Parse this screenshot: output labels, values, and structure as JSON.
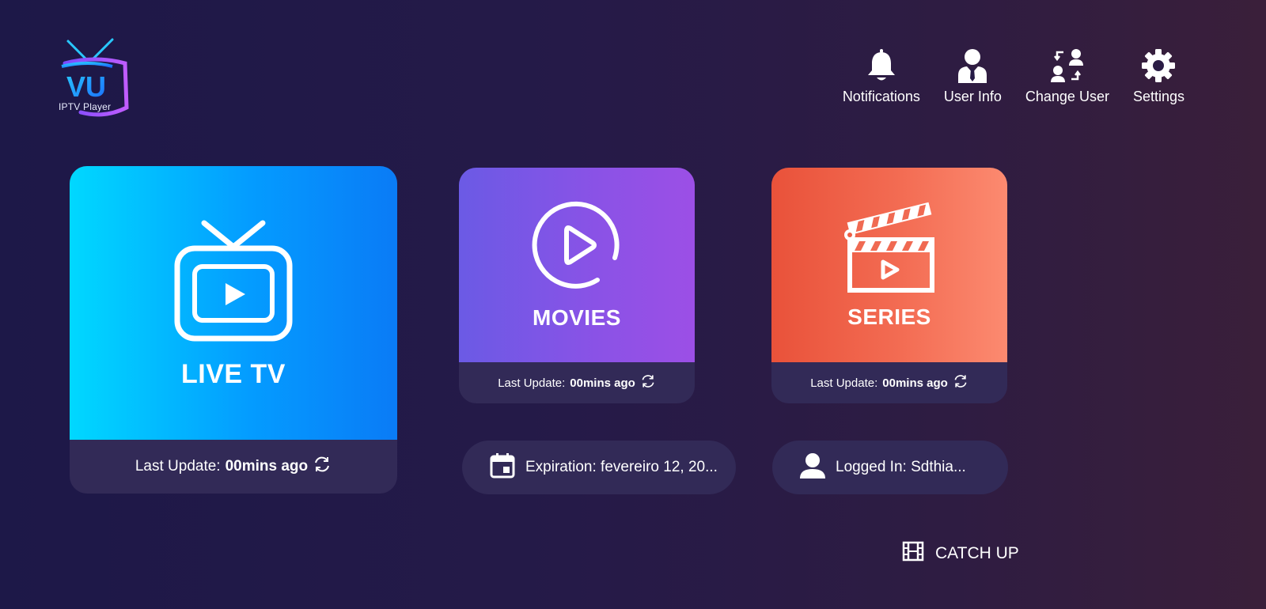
{
  "app": {
    "logo_text": "IPTV Player",
    "logo_mark": "VU"
  },
  "nav": [
    {
      "label": "Notifications",
      "icon": "bell-icon"
    },
    {
      "label": "User Info",
      "icon": "user-tie-icon"
    },
    {
      "label": "Change User",
      "icon": "switch-user-icon"
    },
    {
      "label": "Settings",
      "icon": "gear-icon"
    }
  ],
  "cards": {
    "live": {
      "title": "LIVE TV",
      "update_label": "Last Update:",
      "update_value": "00mins ago"
    },
    "movies": {
      "title": "MOVIES",
      "update_label": "Last Update:",
      "update_value": "00mins ago"
    },
    "series": {
      "title": "SERIES",
      "update_label": "Last Update:",
      "update_value": "00mins ago"
    }
  },
  "info": {
    "expiration": "Expiration: fevereiro 12, 20...",
    "logged_in": "Logged In: Sdthia..."
  },
  "catchup": {
    "label": "CATCH UP"
  },
  "colors": {
    "live_gradient": [
      "#00d8ff",
      "#0a7bf6"
    ],
    "movies_gradient": [
      "#6b5ae5",
      "#9c4fe6"
    ],
    "series_gradient": [
      "#e9523a",
      "#fc8a70"
    ],
    "panel": "#322a57"
  }
}
